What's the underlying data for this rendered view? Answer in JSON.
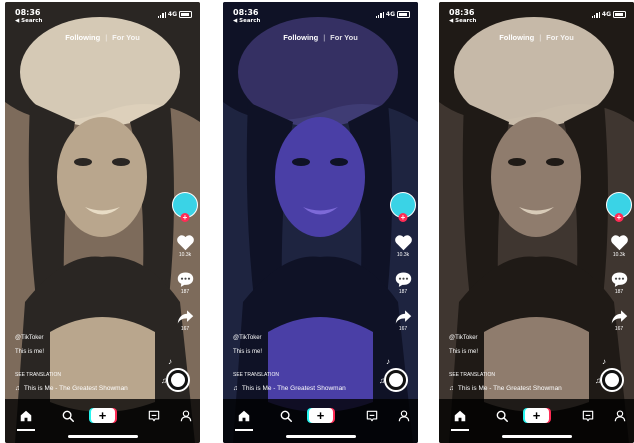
{
  "screens": [
    {
      "status": {
        "time": "08:36",
        "back": "◀ Search",
        "network": "4G"
      },
      "feed_tabs": {
        "following": "Following",
        "separator": "|",
        "for_you": "For You"
      },
      "rail": {
        "likes": "10.3k",
        "comments": "187",
        "shares": "167"
      },
      "caption": {
        "handle": "@TikToker",
        "description": "This is me!",
        "see_translation": "SEE TRANSLATION",
        "sound": "This is Me - The Greatest Showman"
      },
      "palette": {
        "bg": "#7d6b5b",
        "mid": "#b9a68d",
        "light": "#e8dcc5",
        "dark": "#2a2623"
      }
    },
    {
      "status": {
        "time": "08:36",
        "back": "◀ Search",
        "network": "4G"
      },
      "feed_tabs": {
        "following": "Following",
        "separator": "|",
        "for_you": "For You"
      },
      "rail": {
        "likes": "10.3k",
        "comments": "187",
        "shares": "167"
      },
      "caption": {
        "handle": "@TikToker",
        "description": "This is me!",
        "see_translation": "SEE TRANSLATION",
        "sound": "This is Me - The Greatest Showman"
      },
      "palette": {
        "bg": "#1e2440",
        "mid": "#4a3fa6",
        "light": "#7d6ad8",
        "dark": "#0f1226"
      }
    },
    {
      "status": {
        "time": "08:36",
        "back": "◀ Search",
        "network": "4G"
      },
      "feed_tabs": {
        "following": "Following",
        "separator": "|",
        "for_you": "For You"
      },
      "rail": {
        "likes": "10.3k",
        "comments": "187",
        "shares": "167"
      },
      "caption": {
        "handle": "@TikToker",
        "description": "This is me!",
        "see_translation": "SEE TRANSLATION",
        "sound": "This is Me - The Greatest Showman"
      },
      "palette": {
        "bg": "#3f3630",
        "mid": "#8f7c6d",
        "light": "#d8cbb8",
        "dark": "#1f1a16"
      }
    }
  ],
  "icons": [
    "home-icon",
    "search-icon",
    "create-plus-icon",
    "inbox-icon",
    "profile-icon",
    "heart-icon",
    "comment-icon",
    "share-icon",
    "music-note-icon"
  ],
  "accent": {
    "tiktok_red": "#fe2c55",
    "tiktok_cyan": "#25f4ee",
    "avatar": "#3ad3e6"
  }
}
